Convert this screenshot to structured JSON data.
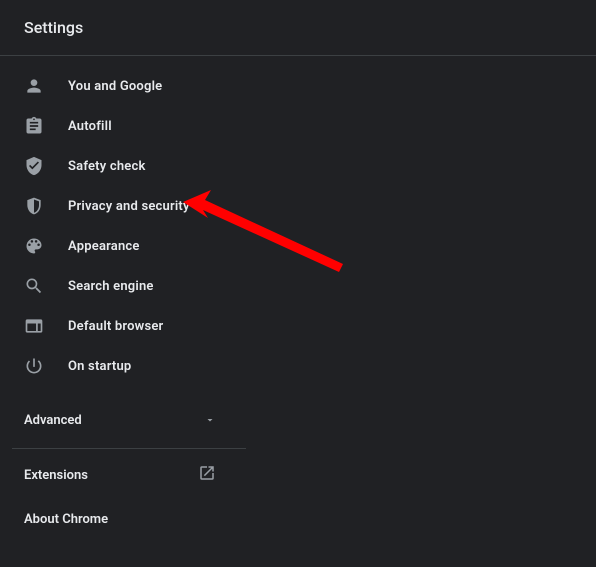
{
  "header": {
    "title": "Settings"
  },
  "sidebar": {
    "items": [
      {
        "label": "You and Google"
      },
      {
        "label": "Autofill"
      },
      {
        "label": "Safety check"
      },
      {
        "label": "Privacy and security"
      },
      {
        "label": "Appearance"
      },
      {
        "label": "Search engine"
      },
      {
        "label": "Default browser"
      },
      {
        "label": "On startup"
      }
    ],
    "advanced_label": "Advanced",
    "links": [
      {
        "label": "Extensions"
      },
      {
        "label": "About Chrome"
      }
    ]
  },
  "annotation": {
    "target_item_index": 3
  }
}
